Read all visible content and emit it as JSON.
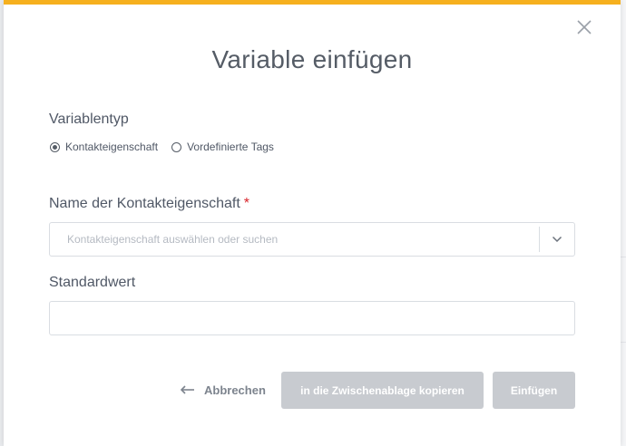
{
  "dialog": {
    "title": "Variable einfügen",
    "accent_color": "#f6b01e",
    "close_icon": "close-icon"
  },
  "variable_type": {
    "label": "Variablentyp",
    "options": [
      {
        "label": "Kontakteigenschaft",
        "selected": true
      },
      {
        "label": "Vordefinierte Tags",
        "selected": false
      }
    ]
  },
  "contact_property": {
    "label": "Name der Kontakteigenschaft",
    "required_marker": "*",
    "placeholder": "Kontakteigenschaft auswählen oder suchen",
    "caret_icon": "chevron-down-icon"
  },
  "default_value": {
    "label": "Standardwert",
    "value": ""
  },
  "actions": {
    "cancel_label": "Abbrechen",
    "cancel_icon": "arrow-left-icon",
    "copy_label": "in die Zwischenablage kopieren",
    "insert_label": "Einfügen",
    "disabled_color": "#c8cbd0"
  }
}
